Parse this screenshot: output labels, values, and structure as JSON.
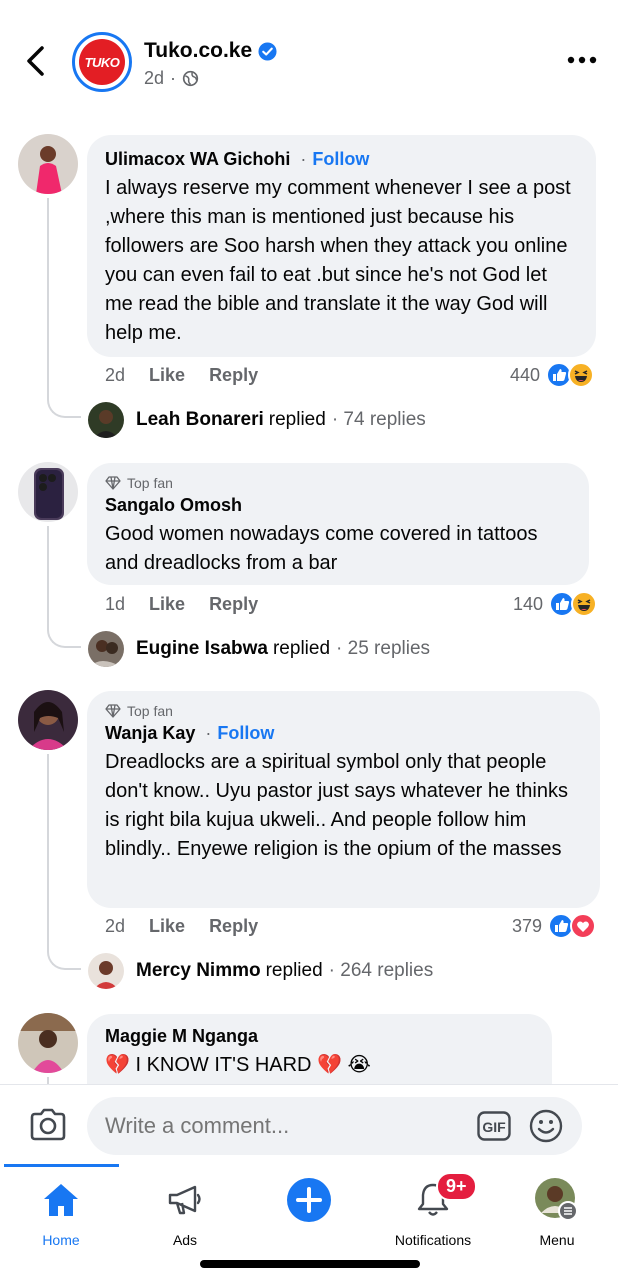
{
  "header": {
    "page_name": "Tuko.co.ke",
    "logo_text": "TUKO",
    "time": "2d",
    "meta_sep": "·"
  },
  "comments": [
    {
      "author": "Ulimacox WA Gichohi",
      "follow": "Follow",
      "text": "I always reserve my comment whenever I see a post ,where this man is mentioned just because his followers are Soo harsh when they attack you online you can even fail to eat .but since he's not God let me read the bible and translate it the way God will help me.",
      "time": "2d",
      "like": "Like",
      "reply": "Reply",
      "reaction_count": "440",
      "reactions": [
        "like-reaction-icon",
        "haha-reaction-icon"
      ],
      "reply_author": "Leah Bonareri",
      "reply_verb": "replied",
      "reply_count": "· 74 replies"
    },
    {
      "badge": "Top fan",
      "author": "Sangalo Omosh",
      "text": "Good women nowadays come covered in tattoos and dreadlocks from a bar",
      "time": "1d",
      "like": "Like",
      "reply": "Reply",
      "reaction_count": "140",
      "reactions": [
        "like-reaction-icon",
        "haha-reaction-icon"
      ],
      "reply_author": "Eugine Isabwa",
      "reply_verb": "replied",
      "reply_count": "· 25 replies"
    },
    {
      "badge": "Top fan",
      "author": "Wanja Kay",
      "follow": "Follow",
      "text": "Dreadlocks are a spiritual symbol only that people don't know.. Uyu pastor just says whatever he thinks is right bila kujua ukweli..  And people follow him blindly.. Enyewe religion is the opium of the masses",
      "time": "2d",
      "like": "Like",
      "reply": "Reply",
      "reaction_count": "379",
      "reactions": [
        "like-reaction-icon",
        "love-reaction-icon"
      ],
      "reply_author": "Mercy Nimmo",
      "reply_verb": "replied",
      "reply_count": "· 264 replies"
    },
    {
      "author": "Maggie M Nganga",
      "text": "💔 I KNOW IT'S HARD 💔 😭"
    }
  ],
  "composer": {
    "placeholder": "Write a comment...",
    "gif_label": "GIF"
  },
  "nav": {
    "home": "Home",
    "ads": "Ads",
    "notifications": "Notifications",
    "notifications_badge": "9+",
    "menu": "Menu"
  },
  "colors": {
    "accent": "#1877f2",
    "bubble": "#f0f2f5",
    "secondary_text": "#65676b",
    "badge": "#e41e3f"
  }
}
